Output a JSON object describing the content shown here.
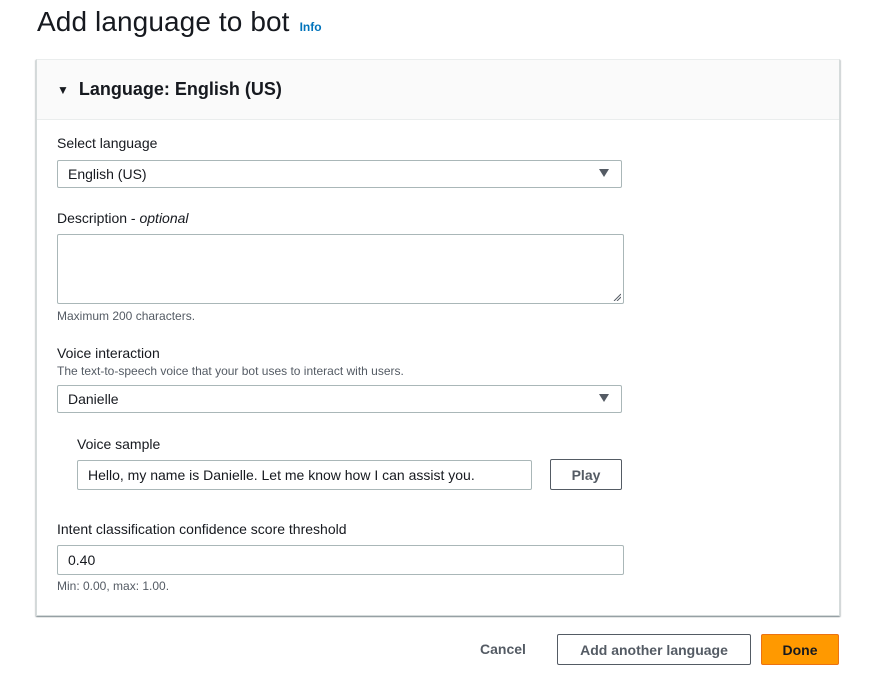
{
  "page": {
    "title": "Add language to bot",
    "info_label": "Info"
  },
  "panel": {
    "title": "Language: English (US)",
    "select_language": {
      "label": "Select language",
      "value": "English (US)"
    },
    "description": {
      "label": "Description",
      "optional": "optional",
      "value": "",
      "hint": "Maximum 200 characters."
    },
    "voice_interaction": {
      "label": "Voice interaction",
      "hint": "The text-to-speech voice that your bot uses to interact with users.",
      "value": "Danielle"
    },
    "voice_sample": {
      "label": "Voice sample",
      "value": "Hello, my name is Danielle. Let me know how I can assist you.",
      "play_label": "Play"
    },
    "threshold": {
      "label": "Intent classification confidence score threshold",
      "value": "0.40",
      "hint": "Min: 0.00, max: 1.00."
    }
  },
  "footer": {
    "cancel_label": "Cancel",
    "add_another_label": "Add another language",
    "done_label": "Done"
  },
  "colors": {
    "primary_button": "#ff9900",
    "link": "#0073bb"
  }
}
